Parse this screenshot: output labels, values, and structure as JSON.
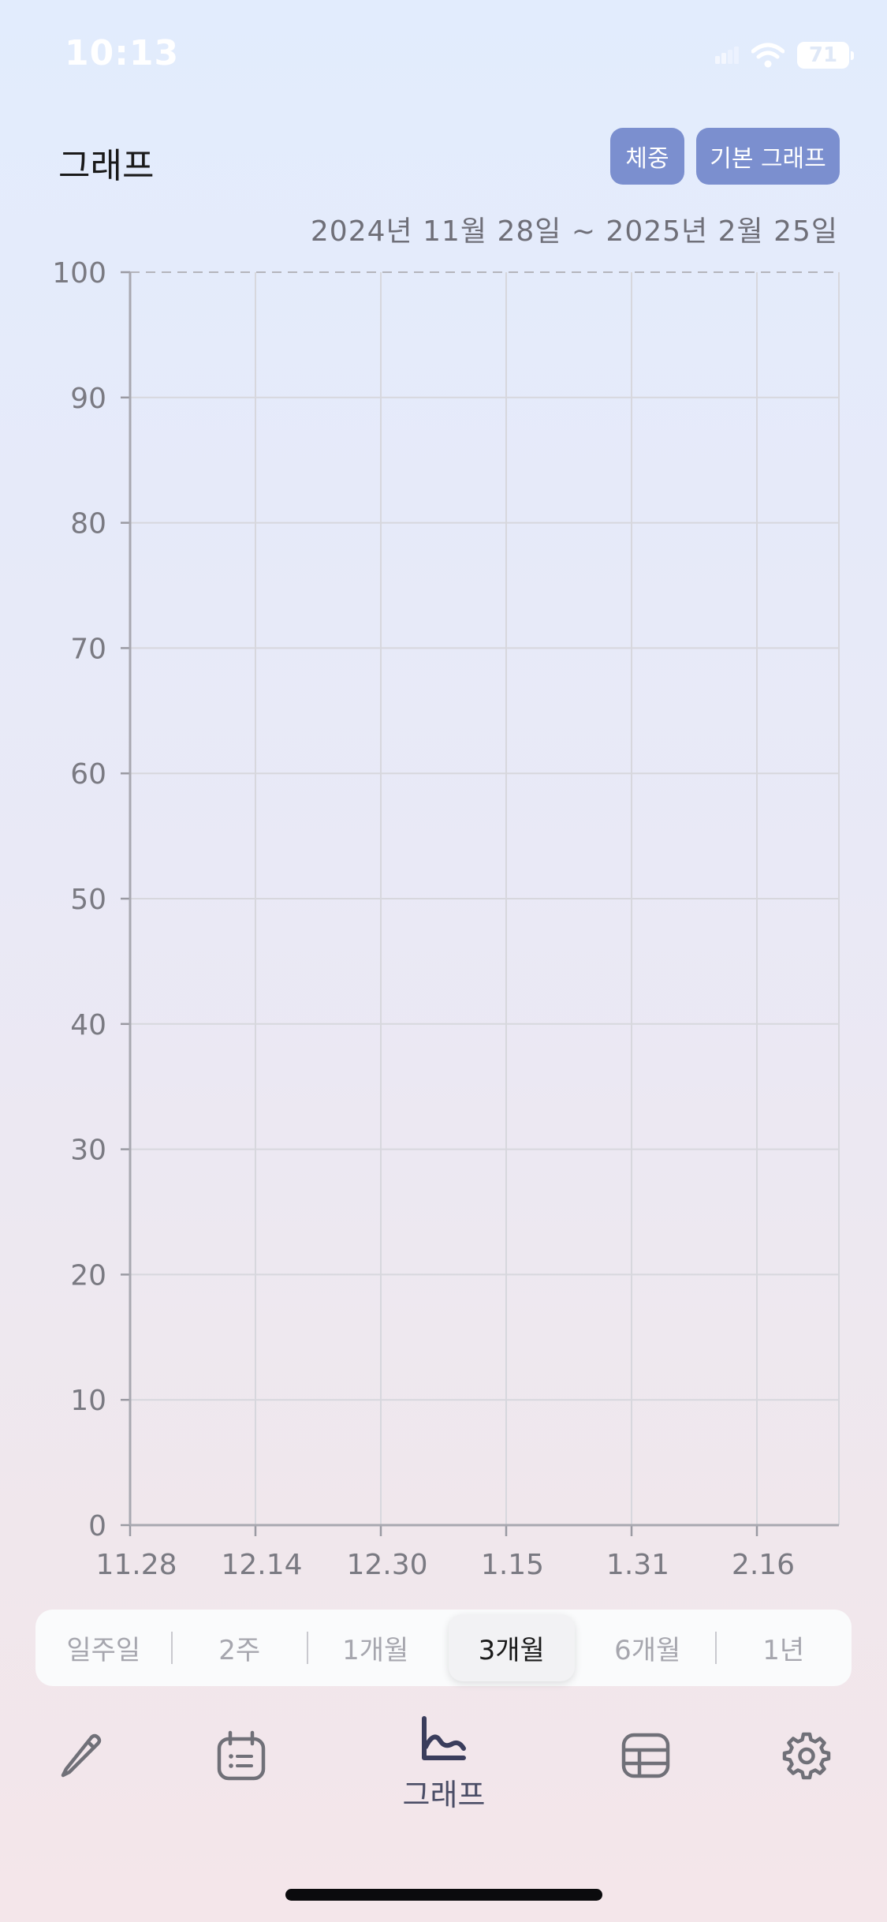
{
  "status_bar": {
    "time": "10:13",
    "battery": "71",
    "icons": [
      "signal-icon",
      "wifi-icon",
      "battery-icon"
    ]
  },
  "header": {
    "title": "그래프",
    "weight_button": "체중",
    "basic_graph_button": "기본 그래프",
    "date_range": "2024년 11월 28일 ~ 2025년 2월 25일"
  },
  "colors": {
    "accent_button": "#7b8fcf",
    "tab_active": "#3a3d5c",
    "tab_inactive": "#7a7a82"
  },
  "chart_data": {
    "type": "line",
    "x_tick_labels": [
      "11.28",
      "12.14",
      "12.30",
      "1.15",
      "1.31",
      "2.16"
    ],
    "y_tick_labels": [
      "0",
      "10",
      "20",
      "30",
      "40",
      "50",
      "60",
      "70",
      "80",
      "90",
      "100"
    ],
    "ylim": [
      0,
      100
    ],
    "series": [],
    "grid": true
  },
  "period_selector": {
    "options": [
      "일주일",
      "2주",
      "1개월",
      "3개월",
      "6개월",
      "1년"
    ],
    "selected": "3개월"
  },
  "tab_bar": {
    "items": [
      {
        "icon": "pencil-icon",
        "label": ""
      },
      {
        "icon": "calendar-icon",
        "label": ""
      },
      {
        "icon": "graph-icon",
        "label": "그래프"
      },
      {
        "icon": "table-icon",
        "label": ""
      },
      {
        "icon": "gear-icon",
        "label": ""
      }
    ]
  }
}
